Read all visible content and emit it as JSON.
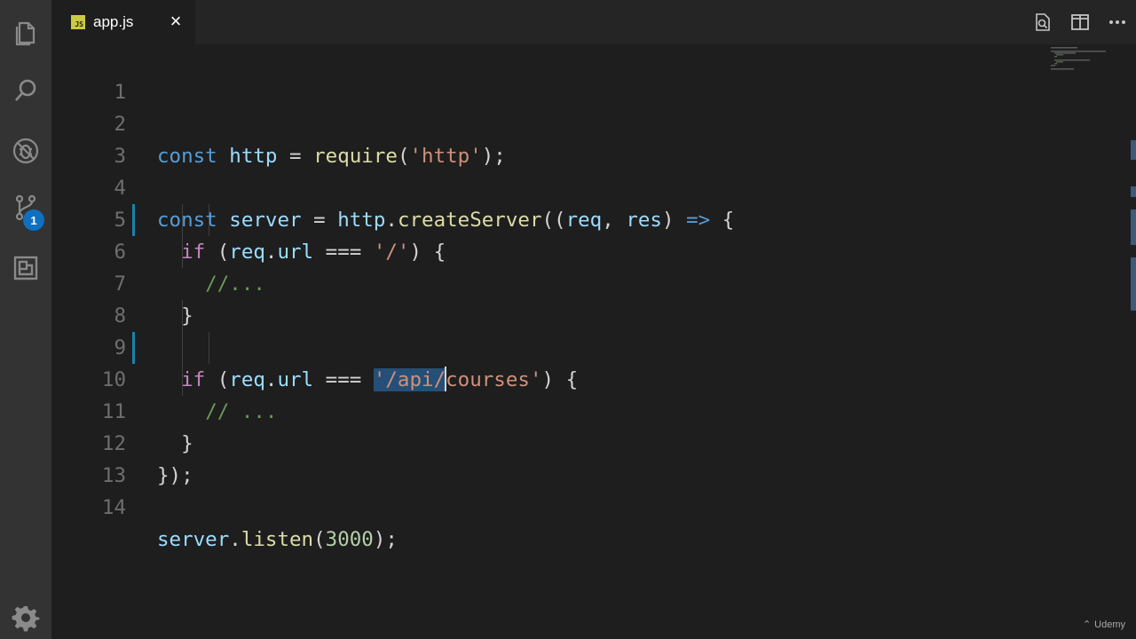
{
  "activity_bar": {
    "items": [
      {
        "name": "explorer-icon"
      },
      {
        "name": "search-icon"
      },
      {
        "name": "debug-icon"
      },
      {
        "name": "source-control-icon",
        "badge": "1"
      },
      {
        "name": "extensions-icon"
      }
    ],
    "settings": "gear-icon"
  },
  "tab": {
    "file_type_badge": "JS",
    "title": "app.js",
    "close_glyph": "×"
  },
  "tab_actions": [
    "open-changes-icon",
    "split-editor-icon",
    "more-actions-icon"
  ],
  "editor": {
    "line_numbers": [
      "1",
      "2",
      "3",
      "4",
      "5",
      "6",
      "7",
      "8",
      "9",
      "10",
      "11",
      "12",
      "13",
      "14"
    ],
    "lines": {
      "l2": {
        "kw": "const",
        "name": "http",
        "eq": "=",
        "fn": "require",
        "open": "(",
        "str": "'http'",
        "close": ");"
      },
      "l4": {
        "kw": "const",
        "name": "server",
        "eq": "=",
        "obj": "http",
        "dot": ".",
        "fn": "createServer",
        "open": "((",
        "p1": "req",
        "comma": ",",
        "p2": "res",
        "close": ")",
        "arrow": "=>",
        "brace": "{"
      },
      "l5": {
        "kw": "if",
        "open": "(",
        "obj": "req",
        "dot": ".",
        "prop": "url",
        "op": "===",
        "str": "'/'",
        "close": ")",
        "brace": "{"
      },
      "l6": {
        "comment": "//..."
      },
      "l7": {
        "brace": "}"
      },
      "l9": {
        "kw": "if",
        "open": "(",
        "obj": "req",
        "dot": ".",
        "prop": "url",
        "op": "===",
        "str_sel": "'/api/",
        "str_rest": "courses'",
        "close": ")",
        "brace": "{"
      },
      "l10": {
        "comment": "// ..."
      },
      "l11": {
        "brace": "}"
      },
      "l12": {
        "close": "});"
      },
      "l14": {
        "obj": "server",
        "dot": ".",
        "fn": "listen",
        "open": "(",
        "num": "3000",
        "close": ");"
      }
    }
  },
  "watermark": "Udemy",
  "colors": {
    "activity_bar": "#333333",
    "editor_bg": "#1e1e1e",
    "keyword": "#569cd6",
    "control_keyword": "#c586c0",
    "function": "#dcdcaa",
    "variable": "#9cdcfe",
    "string": "#ce9178",
    "number": "#b5cea8",
    "comment": "#6a9955",
    "selection": "#264f78",
    "badge": "#0e70c0"
  }
}
